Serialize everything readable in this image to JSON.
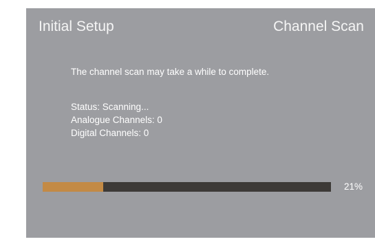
{
  "header": {
    "left_title": "Initial Setup",
    "right_title": "Channel Scan"
  },
  "message": "The channel scan may take a while to complete.",
  "status": {
    "scan_status": "Status: Scanning...",
    "analogue_channels": "Analogue Channels: 0",
    "digital_channels": "Digital Channels: 0"
  },
  "progress": {
    "value": 0.21,
    "label": "21%"
  },
  "colors": {
    "panel_background": "#9c9da1",
    "progress_fill": "#c38a45",
    "progress_track": "#3d3a37",
    "text": "#ffffff"
  }
}
